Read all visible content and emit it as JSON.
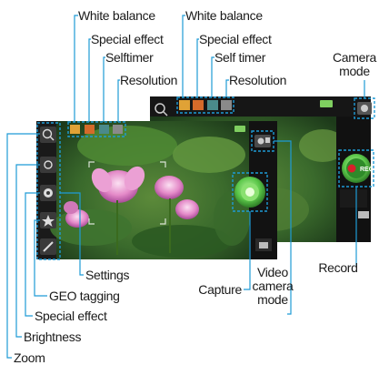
{
  "labels": {
    "white_balance_a": "White balance",
    "white_balance_b": "White balance",
    "special_effect_a": "Special effect",
    "special_effect_b": "Special effect",
    "selftimer": "Selftimer",
    "self_timer": "Self timer",
    "resolution_a": "Resolution",
    "resolution_b": "Resolution",
    "camera_mode": "Camera\nmode",
    "record": "Record",
    "settings": "Settings",
    "geo_tagging": "GEO tagging",
    "special_effect_c": "Special effect",
    "brightness": "Brightness",
    "zoom": "Zoom",
    "capture": "Capture",
    "video_camera_mode": "Video\ncamera\nmode"
  },
  "colors": {
    "accent": "#1e9bd6",
    "record_red": "#d8202a",
    "capture_green": "#5cc84a",
    "photo_bg": "#2f5a2a",
    "lotus_pink": "#e48ac8"
  },
  "icons": {
    "zoom": "magnifier-icon",
    "brightness": "sun-icon",
    "special_effect": "effect-icon",
    "geo_tagging": "star-icon",
    "settings": "wrench-icon",
    "camera_mode": "camera-icon",
    "video_mode": "video-camera-icon",
    "gallery": "gallery-icon"
  }
}
